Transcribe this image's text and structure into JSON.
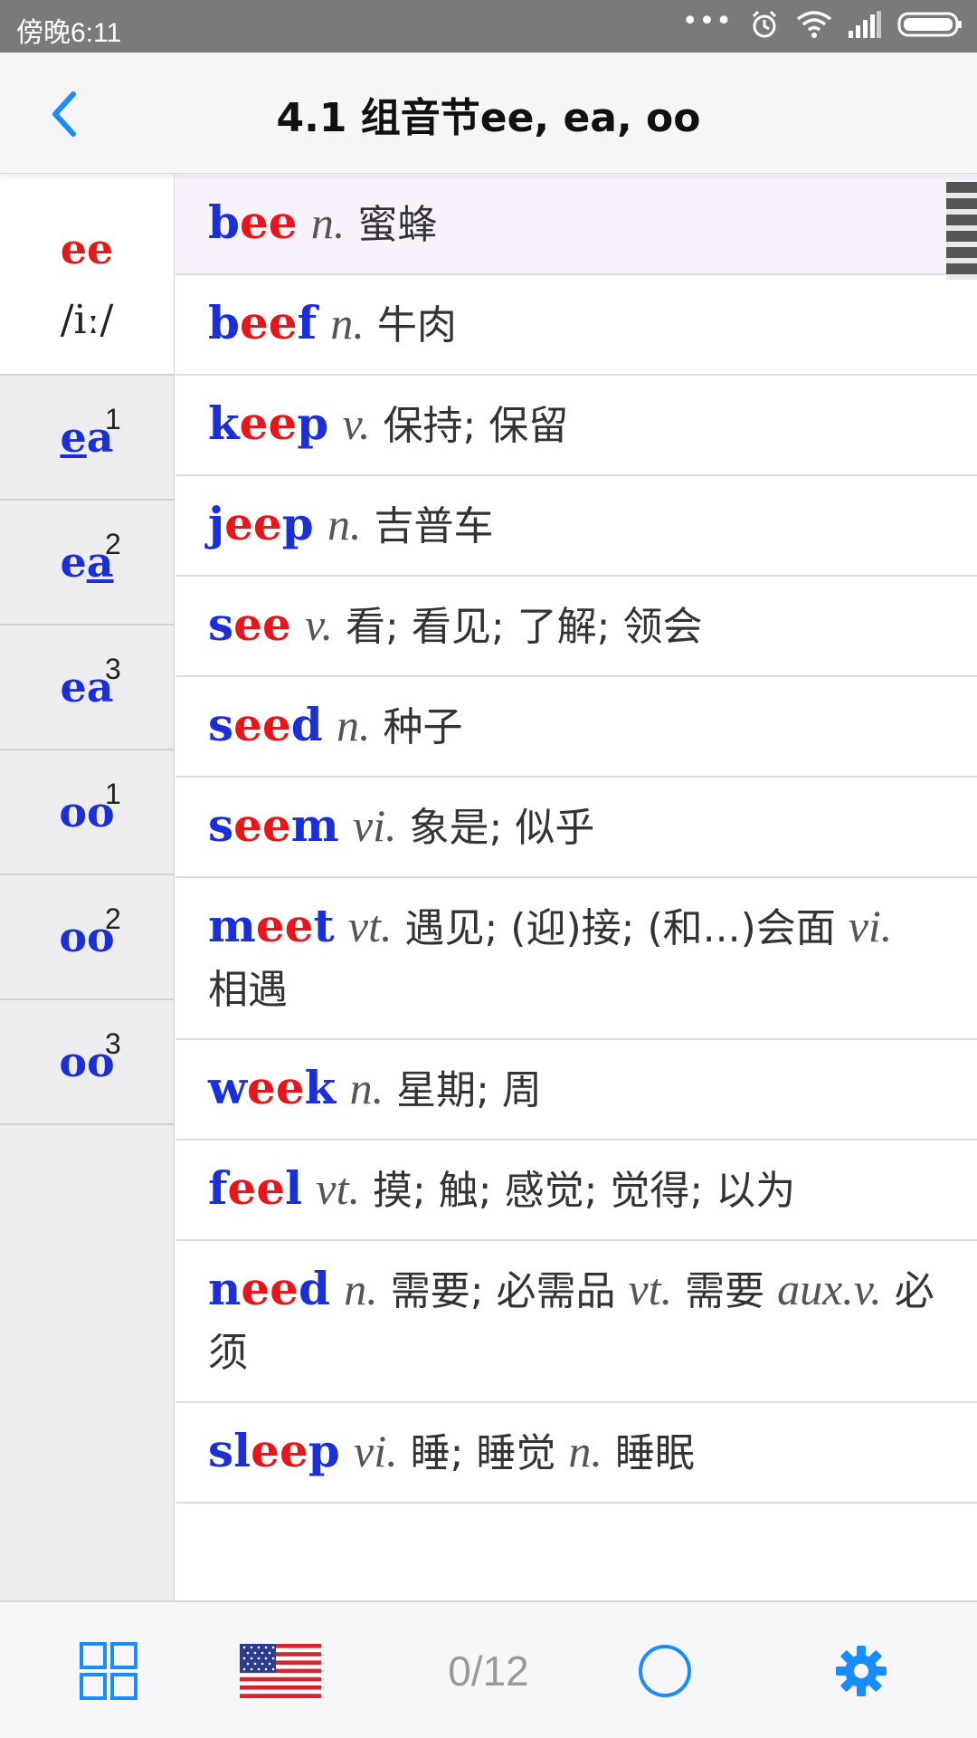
{
  "status_bar": {
    "time": "傍晚6:11",
    "dots": "•••"
  },
  "header": {
    "title": "4.1 组音节ee, ea, oo"
  },
  "sidebar": {
    "tabs": [
      {
        "label": "ee",
        "phonetic": "/iː/",
        "active": true
      },
      {
        "label_a": "e",
        "label_b": "a",
        "underline": "a_first",
        "sup": "1"
      },
      {
        "label_a": "e",
        "label_b": "a",
        "underline": "second",
        "sup": "2"
      },
      {
        "label": "ea",
        "sup": "3"
      },
      {
        "label": "oo",
        "sup": "1"
      },
      {
        "label": "oo",
        "sup": "2"
      },
      {
        "label": "oo",
        "sup": "3"
      }
    ]
  },
  "words": [
    {
      "parts": [
        [
          "b",
          "b"
        ],
        [
          "ee",
          "r"
        ]
      ],
      "def": [
        [
          "n.",
          "pos"
        ],
        [
          " 蜜蜂",
          "def"
        ]
      ]
    },
    {
      "parts": [
        [
          "b",
          "b"
        ],
        [
          "ee",
          "r"
        ],
        [
          "f",
          "b"
        ]
      ],
      "def": [
        [
          "n.",
          "pos"
        ],
        [
          " 牛肉",
          "def"
        ]
      ]
    },
    {
      "parts": [
        [
          "k",
          "b"
        ],
        [
          "ee",
          "r"
        ],
        [
          "p",
          "b"
        ]
      ],
      "def": [
        [
          "v.",
          "pos"
        ],
        [
          " 保持; 保留",
          "def"
        ]
      ]
    },
    {
      "parts": [
        [
          "j",
          "b"
        ],
        [
          "ee",
          "r"
        ],
        [
          "p",
          "b"
        ]
      ],
      "def": [
        [
          "n.",
          "pos"
        ],
        [
          " 吉普车",
          "def"
        ]
      ]
    },
    {
      "parts": [
        [
          "s",
          "b"
        ],
        [
          "ee",
          "r"
        ]
      ],
      "def": [
        [
          "v.",
          "pos"
        ],
        [
          " 看; 看见; 了解; 领会",
          "def"
        ]
      ]
    },
    {
      "parts": [
        [
          "s",
          "b"
        ],
        [
          "ee",
          "r"
        ],
        [
          "d",
          "b"
        ]
      ],
      "def": [
        [
          "n.",
          "pos"
        ],
        [
          " 种子",
          "def"
        ]
      ]
    },
    {
      "parts": [
        [
          "s",
          "b"
        ],
        [
          "ee",
          "r"
        ],
        [
          "m",
          "b"
        ]
      ],
      "def": [
        [
          "vi.",
          "pos"
        ],
        [
          " 象是; 似乎",
          "def"
        ]
      ]
    },
    {
      "parts": [
        [
          "m",
          "b"
        ],
        [
          "ee",
          "r"
        ],
        [
          "t",
          "b"
        ]
      ],
      "def": [
        [
          "vt.",
          "pos"
        ],
        [
          " 遇见; (迎)接; (和...)会面 ",
          "def"
        ],
        [
          "vi.",
          "pos"
        ],
        [
          " 相遇",
          "def"
        ]
      ]
    },
    {
      "parts": [
        [
          "w",
          "b"
        ],
        [
          "ee",
          "r"
        ],
        [
          "k",
          "b"
        ]
      ],
      "def": [
        [
          "n.",
          "pos"
        ],
        [
          " 星期; 周",
          "def"
        ]
      ]
    },
    {
      "parts": [
        [
          "f",
          "b"
        ],
        [
          "ee",
          "r"
        ],
        [
          "l",
          "b"
        ]
      ],
      "def": [
        [
          "vt.",
          "pos"
        ],
        [
          " 摸; 触; 感觉; 觉得; 以为",
          "def"
        ]
      ]
    },
    {
      "parts": [
        [
          "n",
          "b"
        ],
        [
          "ee",
          "r"
        ],
        [
          "d",
          "b"
        ]
      ],
      "def": [
        [
          "n.",
          "pos"
        ],
        [
          " 需要; 必需品 ",
          "def"
        ],
        [
          "vt.",
          "pos"
        ],
        [
          " 需要 ",
          "def"
        ],
        [
          "aux.v.",
          "pos"
        ],
        [
          " 必须",
          "def"
        ]
      ]
    },
    {
      "parts": [
        [
          "sl",
          "b"
        ],
        [
          "ee",
          "r"
        ],
        [
          "p",
          "b"
        ]
      ],
      "def": [
        [
          "vi.",
          "pos"
        ],
        [
          " 睡; 睡觉 ",
          "def"
        ],
        [
          "n.",
          "pos"
        ],
        [
          " 睡眠",
          "def"
        ]
      ]
    }
  ],
  "bottom_bar": {
    "counter": "0/12"
  },
  "colors": {
    "accent_blue": "#1a8cff",
    "word_blue": "#1a2fd8",
    "word_red": "#e8161a"
  }
}
